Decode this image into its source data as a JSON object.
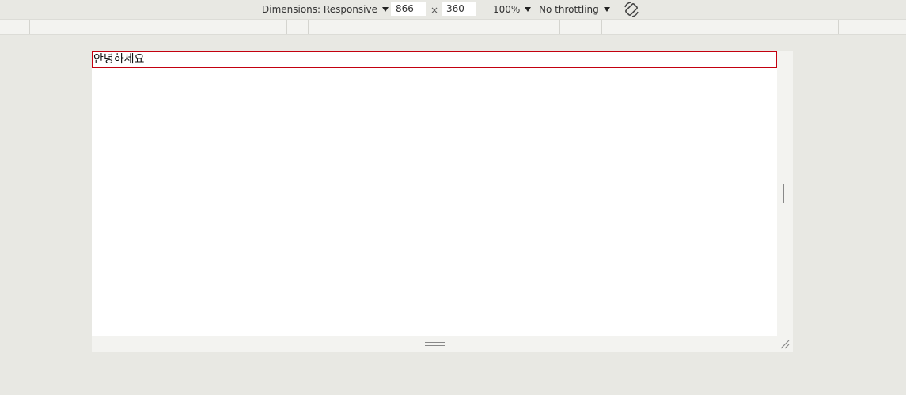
{
  "toolbar": {
    "dimensions_label": "Dimensions: Responsive",
    "width_value": "866",
    "times_symbol": "×",
    "height_value": "360",
    "zoom_label": "100%",
    "throttling_label": "No throttling",
    "rotate_icon": "rotate-icon"
  },
  "viewport": {
    "text": "안녕하세요",
    "highlight_color": "#c3000f"
  },
  "icons": {
    "right_handle": "vertical-grip-icon",
    "bottom_handle": "horizontal-grip-icon",
    "corner_handle": "resize-corner-icon"
  }
}
